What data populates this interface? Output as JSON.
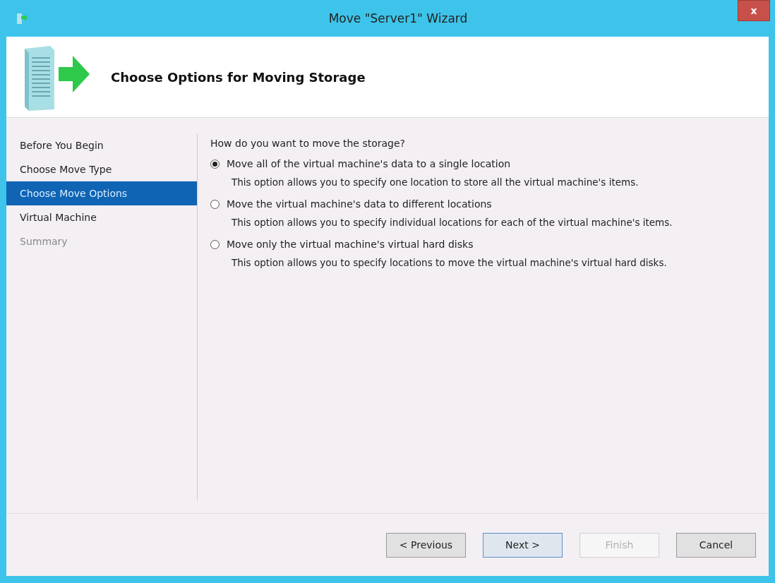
{
  "window": {
    "title": "Move \"Server1\" Wizard",
    "close": "x"
  },
  "header": {
    "title": "Choose Options for Moving Storage"
  },
  "steps": [
    {
      "label": "Before You Begin",
      "selected": false,
      "disabled": false
    },
    {
      "label": "Choose Move Type",
      "selected": false,
      "disabled": false
    },
    {
      "label": "Choose Move Options",
      "selected": true,
      "disabled": false
    },
    {
      "label": "Virtual Machine",
      "selected": false,
      "disabled": false
    },
    {
      "label": "Summary",
      "selected": false,
      "disabled": true
    }
  ],
  "question": "How do you want to move the storage?",
  "options": [
    {
      "label": "Move all of the virtual machine's data to a single location",
      "description": "This option allows you to specify one location to store all the virtual machine's items.",
      "selected": true
    },
    {
      "label": "Move the virtual machine's data to different locations",
      "description": "This option allows you to specify individual locations for each of the virtual machine's items.",
      "selected": false
    },
    {
      "label": "Move only the virtual machine's virtual hard disks",
      "description": "This option allows you to specify locations to move the virtual machine's virtual hard disks.",
      "selected": false
    }
  ],
  "buttons": [
    {
      "label": "< Previous",
      "default": false,
      "disabled": false
    },
    {
      "label": "Next >",
      "default": true,
      "disabled": false
    },
    {
      "label": "Finish",
      "default": false,
      "disabled": true
    },
    {
      "label": "Cancel",
      "default": false,
      "disabled": false
    }
  ]
}
